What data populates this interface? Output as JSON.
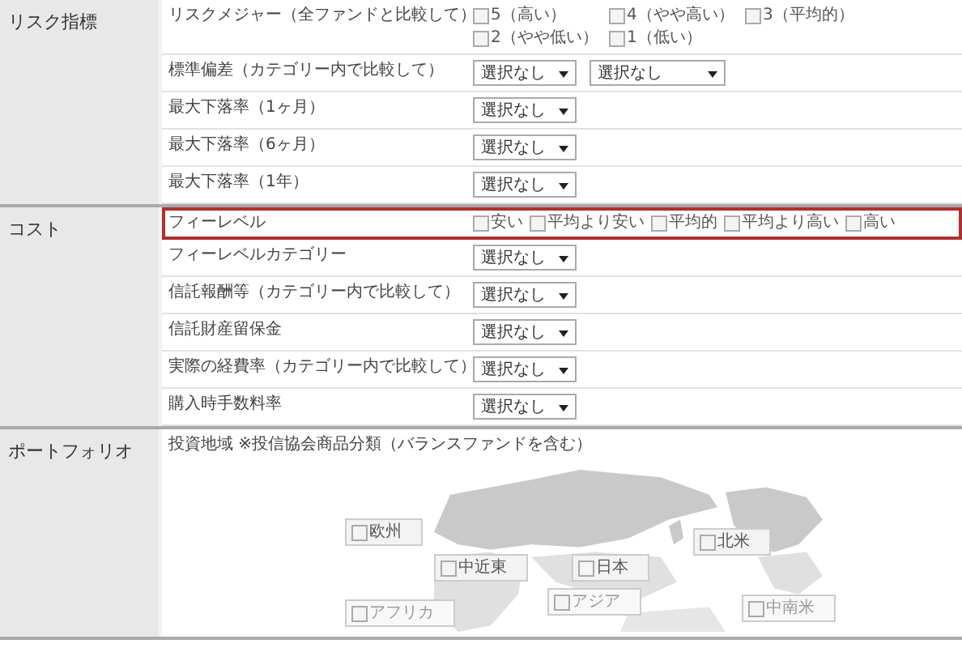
{
  "sections": [
    {
      "title": "リスク指標",
      "rows": [
        {
          "label": "リスクメジャー（全ファンドと比較して）",
          "kind": "checkboxes",
          "highlighted": false,
          "options": [
            {
              "label": "5（高い）",
              "checked": false
            },
            {
              "label": "4（やや高い）",
              "checked": false
            },
            {
              "label": "3（平均的）",
              "checked": false
            },
            {
              "label": "2（やや低い）",
              "checked": false
            },
            {
              "label": "1（低い）",
              "checked": false
            }
          ]
        },
        {
          "label": "標準偏差（カテゴリー内で比較して）",
          "kind": "selects",
          "highlighted": false,
          "selects": [
            "選択なし",
            "選択なし"
          ]
        },
        {
          "label": "最大下落率（1ヶ月）",
          "kind": "selects",
          "highlighted": false,
          "selects": [
            "選択なし"
          ]
        },
        {
          "label": "最大下落率（6ヶ月）",
          "kind": "selects",
          "highlighted": false,
          "selects": [
            "選択なし"
          ]
        },
        {
          "label": "最大下落率（1年）",
          "kind": "selects",
          "highlighted": false,
          "selects": [
            "選択なし"
          ]
        }
      ]
    },
    {
      "title": "コスト",
      "rows": [
        {
          "label": "フィーレベル",
          "kind": "checkboxes",
          "highlighted": true,
          "options": [
            {
              "label": "安い",
              "checked": false
            },
            {
              "label": "平均より安い",
              "checked": false
            },
            {
              "label": "平均的",
              "checked": false
            },
            {
              "label": "平均より高い",
              "checked": false
            },
            {
              "label": "高い",
              "checked": false
            }
          ]
        },
        {
          "label": "フィーレベルカテゴリー",
          "kind": "selects",
          "highlighted": false,
          "selects": [
            "選択なし"
          ]
        },
        {
          "label": "信託報酬等（カテゴリー内で比較して）",
          "kind": "selects",
          "highlighted": false,
          "selects": [
            "選択なし"
          ]
        },
        {
          "label": "信託財産留保金",
          "kind": "selects",
          "highlighted": false,
          "selects": [
            "選択なし"
          ]
        },
        {
          "label": "実際の経費率（カテゴリー内で比較して）",
          "kind": "selects",
          "highlighted": false,
          "selects": [
            "選択なし"
          ]
        },
        {
          "label": "購入時手数料率",
          "kind": "selects",
          "highlighted": false,
          "selects": [
            "選択なし"
          ]
        }
      ]
    },
    {
      "title": "ポートフォリオ",
      "rows": [
        {
          "label": "投資地域 ※投信協会商品分類（バランスファンドを含む）",
          "kind": "map",
          "highlighted": false,
          "regions": [
            {
              "label": "欧州",
              "checked": false
            },
            {
              "label": "中近東",
              "checked": false
            },
            {
              "label": "日本",
              "checked": false
            },
            {
              "label": "北米",
              "checked": false
            },
            {
              "label": "アフリカ",
              "checked": false
            },
            {
              "label": "アジア",
              "checked": false
            },
            {
              "label": "中南米",
              "checked": false
            }
          ]
        }
      ]
    }
  ]
}
